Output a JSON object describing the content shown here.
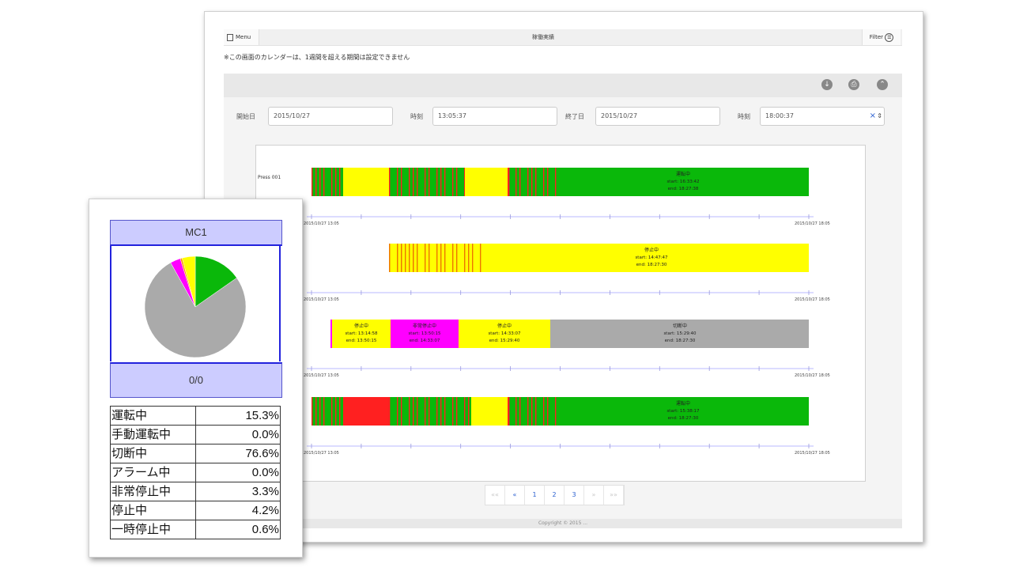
{
  "back_window": {
    "menu_label": "Menu",
    "page_title": "稼働実績",
    "filter_label": "Filter",
    "notice": "※この画面のカレンダーは、1週間を超える期間は設定できません",
    "toolbar_icons": [
      "download-icon",
      "print-icon",
      "collapse-icon"
    ],
    "fields": {
      "start_date_label": "開始日",
      "start_date_value": "2015/10/27",
      "start_time_label": "時刻",
      "start_time_value": "13:05:37",
      "end_date_label": "終了日",
      "end_date_value": "2015/10/27",
      "end_time_label": "時刻",
      "end_time_value": "18:00:37"
    },
    "pagination": [
      "««",
      "«",
      "1",
      "2",
      "3",
      "»",
      "»»"
    ],
    "footer": "Copyright © 2015 ..."
  },
  "colors": {
    "running": "#0ab80a",
    "manual": "#ff00ff",
    "cut": "#aaaaaa",
    "alarm": "#ff2020",
    "emergency": "#ff00ff",
    "stop": "#ffff00",
    "pause": "#ff9900",
    "axis": "#c8c8ff",
    "panel_blue": "#ccccff",
    "border_blue": "#2222dd"
  },
  "gantt": {
    "rows": [
      {
        "machine": "Press 001",
        "range_start": "2015/10/27 13:05",
        "range_end": "2015/10/27 18:05",
        "label": {
          "state": "運転中",
          "start": "start: 16:33:42",
          "end": "end: 18:27:38"
        }
      },
      {
        "machine": "",
        "range_start": "2015/10/27 13:05",
        "range_end": "2015/10/27 18:05",
        "label": {
          "state": "停止中",
          "start": "start: 14:47:47",
          "end": "end: 18:27:30"
        }
      },
      {
        "machine": "",
        "range_start": "2015/10/27 13:05",
        "range_end": "2015/10/27 18:05",
        "labels": [
          {
            "state": "停止中",
            "start": "start: 13:14:58",
            "end": "end: 13:50:15"
          },
          {
            "state": "非常停止中",
            "start": "start: 13:50:15",
            "end": "end: 14:33:07"
          },
          {
            "state": "停止中",
            "start": "start: 14:33:07",
            "end": "end: 15:29:40"
          },
          {
            "state": "切断中",
            "start": "start: 15:29:40",
            "end": "end: 18:27:30"
          }
        ]
      },
      {
        "machine": "",
        "range_start": "2015/10/27 13:05",
        "range_end": "2015/10/27 18:05",
        "label": {
          "state": "運転中",
          "start": "start: 15:38:17",
          "end": "end: 18:27:30"
        }
      }
    ]
  },
  "front_window": {
    "machine_name": "MC1",
    "count": "0/0",
    "stats": [
      {
        "label": "運転中",
        "value": "15.3%"
      },
      {
        "label": "手動運転中",
        "value": "0.0%"
      },
      {
        "label": "切断中",
        "value": "76.6%"
      },
      {
        "label": "アラーム中",
        "value": "0.0%"
      },
      {
        "label": "非常停止中",
        "value": "3.3%"
      },
      {
        "label": "停止中",
        "value": "4.2%"
      },
      {
        "label": "一時停止中",
        "value": "0.6%"
      }
    ]
  },
  "chart_data": {
    "type": "pie",
    "title": "MC1",
    "categories": [
      "運転中",
      "手動運転中",
      "切断中",
      "アラーム中",
      "非常停止中",
      "停止中",
      "一時停止中"
    ],
    "values": [
      15.3,
      0.0,
      76.6,
      0.0,
      3.3,
      4.2,
      0.6
    ],
    "colors": [
      "#0ab80a",
      "#00cc66",
      "#aaaaaa",
      "#ff2020",
      "#ff00ff",
      "#ffff00",
      "#ff9900"
    ]
  }
}
